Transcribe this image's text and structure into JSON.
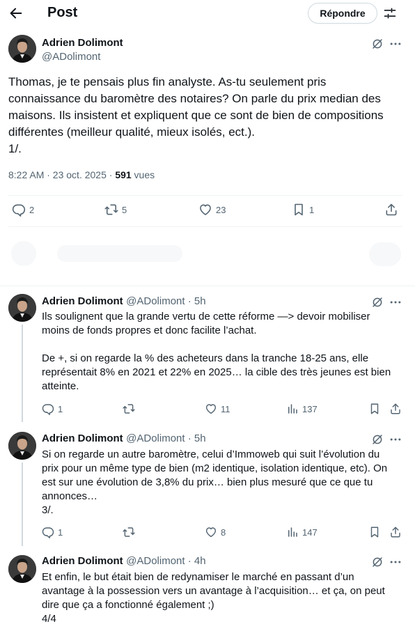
{
  "header": {
    "title": "Post",
    "reply_button": "Répondre"
  },
  "post": {
    "author": "Adrien Dolimont",
    "handle": "@ADolimont",
    "text_lines": [
      "Thomas, je te pensais plus fin analyste. As-tu seulement pris",
      "connaissance du baromètre des notaires? On parle du prix median des",
      "maisons. Ils insistent et expliquent que ce sont de bien de compositions",
      "différentes (meilleur qualité, mieux isolés, ect.).",
      "1/."
    ],
    "time": "8:22 AM · 23 oct. 2025 · ",
    "views_count": "591",
    "views_label": " vues",
    "stats": {
      "replies": "2",
      "reposts": "5",
      "likes": "23",
      "bookmarks": "1"
    }
  },
  "replies": [
    {
      "author": "Adrien Dolimont",
      "handle": "@ADolimont · 5h",
      "paragraphs": [
        [
          "Ils soulignent que la grande vertu de cette réforme —> devoir mobiliser",
          "moins de fonds propres et donc facilite l’achat."
        ],
        [
          "De +, si on regarde la % des acheteurs dans la tranche 18-25 ans, elle",
          "représentait 8% en 2021 et 22% en 2025… la cible des très jeunes est bien",
          "atteinte."
        ]
      ],
      "stats": {
        "replies": "1",
        "reposts": "",
        "likes": "11",
        "views": "137"
      }
    },
    {
      "author": "Adrien Dolimont",
      "handle": "@ADolimont · 5h",
      "paragraphs": [
        [
          "Si on regarde un autre baromètre, celui d’Immoweb qui suit l’évolution du",
          "prix pour un même type de bien (m2 identique, isolation identique, etc). On",
          "est sur une évolution de 3,8% du prix… bien plus mesuré que ce que tu",
          "annonces…",
          "3/."
        ]
      ],
      "stats": {
        "replies": "1",
        "reposts": "",
        "likes": "8",
        "views": "147"
      }
    },
    {
      "author": "Adrien Dolimont",
      "handle": "@ADolimont · 4h",
      "paragraphs": [
        [
          "Et enfin, le but était bien de redynamiser le marché en passant d’un",
          "avantage à la possession vers un avantage à l’acquisition… et ça, on peut",
          "dire que ça a fonctionné également ;)",
          "4/4"
        ]
      ]
    }
  ],
  "colors": {
    "text": "#0f1419",
    "secondary": "#536471",
    "border": "#eff3f4",
    "thread_line": "#cfd9de"
  },
  "icons": [
    "back-arrow-icon",
    "sliders-icon",
    "grok-icon",
    "more-icon",
    "reply-icon",
    "repost-icon",
    "like-icon",
    "views-icon",
    "bookmark-icon",
    "share-icon"
  ]
}
